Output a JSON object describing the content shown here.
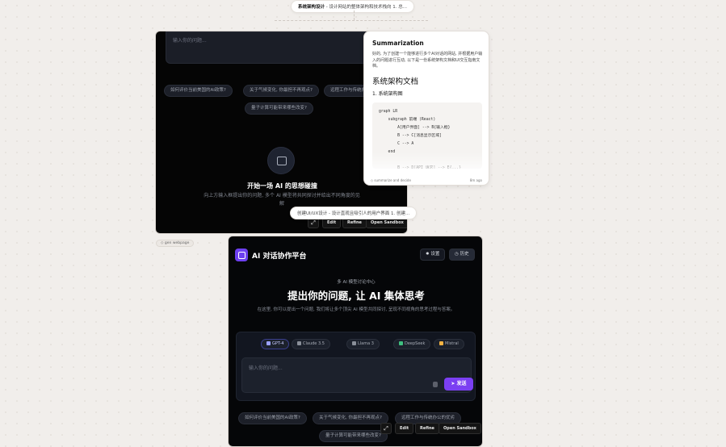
{
  "top_node": {
    "title": "系统架构设计",
    "desc": " - 设计网站的整体架构和技术栈向 1. 总..."
  },
  "mid_node": {
    "title": "",
    "desc": "创建UI/UX设计 - 设计直观且吸引人的用户界面 1. 创建..."
  },
  "card1": {
    "input_placeholder": "输入你的问题...",
    "suggestions": [
      "如何评价当前美国的AI政策?",
      "关于气候变化, 你最担不再观点?",
      "远程工作与传统办",
      "量子计算可能带来哪些改变?"
    ],
    "hero_title": "开始一场 AI 的思想碰撞",
    "hero_sub": "向上方输入框提出你的问题, 多个 AI 模型将共同探讨并给出不同角度的见解",
    "toolbar": {
      "expand_icon": "⤢",
      "edit": "Edit",
      "refine": "Refine",
      "open_sandbox": "Open Sandbox"
    },
    "footer": "gen webpage"
  },
  "summary": {
    "heading": "Summarization",
    "intro": "好的, 为了创建一个能够进行多个AI对话的网站, 并根据用户输入的问题进行互动, 以下是一份系统架构文档和UI交互指南文档。",
    "doc_title": "系统架构文档",
    "section": "1. 系统架构图",
    "code": "graph LR\n    subgraph 前端 (React)\n        A[用户界面] --> B{输入框}\n        B --> C[消息显示区域]\n        C --> A\n    end\n\n        B --> D[API 请求] --> E{...}",
    "footer": "summarize and decide",
    "time": "8m ago"
  },
  "app": {
    "title": "AI 对话协作平台",
    "settings": "设置",
    "history": "历史",
    "tagline": "多 AI 模型讨论中心",
    "headline": "提出你的问题, 让 AI 集体思考",
    "intro": "在这里, 你可以提出一个问题, 我们将让多个顶尖 AI 模型共同探讨, 呈现不同视角的思考过程与答案。",
    "models": [
      {
        "name": "GPT-4",
        "color": "#9aa0ff"
      },
      {
        "name": "Claude 3.5",
        "color": "#8a8f99"
      },
      {
        "name": "Llama 3",
        "color": "#8a8f99"
      },
      {
        "name": "DeepSeek",
        "color": "#3fbf7f"
      },
      {
        "name": "Mistral",
        "color": "#f5b342"
      }
    ],
    "input_placeholder": "输入你的问题...",
    "send": "发送",
    "suggestions": [
      "如何评价当前美国的AI政策?",
      "关于气候变化, 你最担不再观点?",
      "远程工作与传统办公的优劣",
      "量子计算可能带来哪些改变?"
    ],
    "toolbar": {
      "expand_icon": "⤢",
      "edit": "Edit",
      "refine": "Refine",
      "open_sandbox": "Open Sandbox"
    }
  }
}
